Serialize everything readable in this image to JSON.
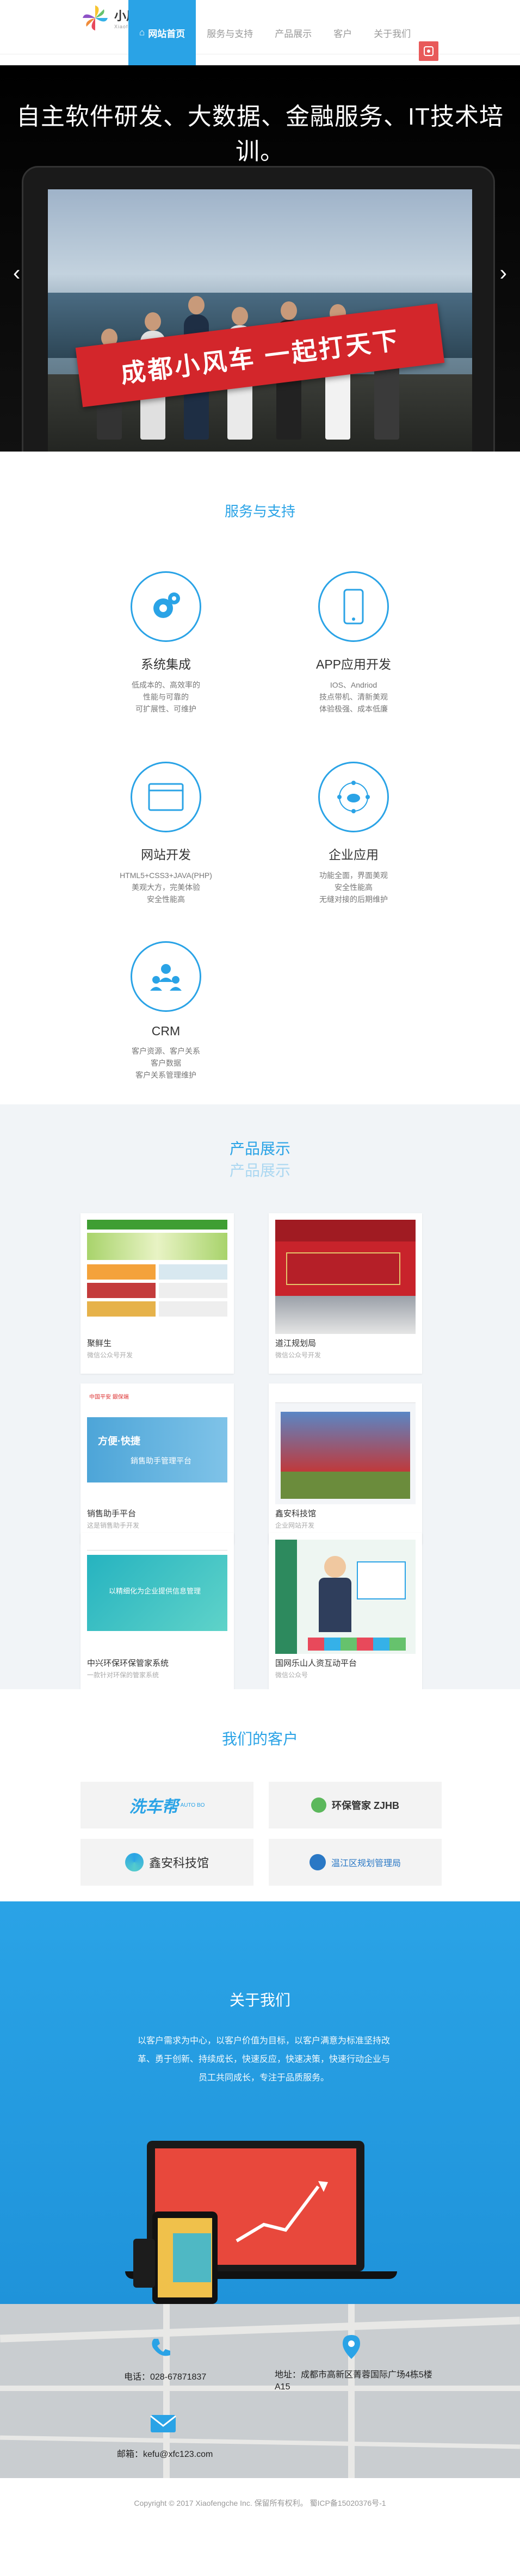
{
  "brand": {
    "name": "小风车",
    "sub": "Xiaofengche"
  },
  "nav": [
    {
      "label": "网站首页",
      "active": true
    },
    {
      "label": "服务与支持"
    },
    {
      "label": "产品展示"
    },
    {
      "label": "客户"
    },
    {
      "label": "关于我们"
    }
  ],
  "banner": {
    "headline": "自主软件研发、大数据、金融服务、IT技术培训。",
    "flag_text": "成都小风车  一起打天下",
    "prev": "‹",
    "next": "›"
  },
  "services": {
    "title": "服务与支持",
    "items": [
      {
        "name": "系统集成",
        "desc": "低成本的、高效率的\n性能与可靠的\n可扩展性、可维护",
        "icon": "gears-icon"
      },
      {
        "name": "APP应用开发",
        "desc": "IOS、Andriod\n技点带机、清新美观\n体验极强、成本低廉",
        "icon": "smartphone-icon"
      },
      {
        "name": "网站开发",
        "desc": "HTML5+CSS3+JAVA(PHP)\n美观大方，完美体验\n安全性能高",
        "icon": "browser-window-icon"
      },
      {
        "name": "企业应用",
        "desc": "功能全面，界面美观\n安全性能高\n无缝对接的后期维护",
        "icon": "network-cloud-icon"
      },
      {
        "name": "CRM",
        "desc": "客户资源、客户关系\n客户数据\n客户关系管理维护",
        "icon": "users-icon"
      }
    ]
  },
  "products": {
    "title": "产品展示",
    "subtitle": "产品展示",
    "items": [
      {
        "name": "聚鲜生",
        "desc": "微信公众号开发"
      },
      {
        "name": "道江规划局",
        "desc": "微信公众号开发"
      },
      {
        "name": "销售助手平台",
        "desc": "这是销售助手开发"
      },
      {
        "name": "鑫安科技馆",
        "desc": "企业网站开发"
      },
      {
        "name": "中兴环保环保管家系统",
        "desc": "一款针对环保的管家系统"
      },
      {
        "name": "国网乐山人资互动平台",
        "desc": "微信公众号"
      }
    ],
    "screens": {
      "p3_header": "中国平安 銀保端",
      "p3_tagline": "銷售助手管理平台",
      "p3_brand": "方便·快捷",
      "p5_banner": "以精细化为企业提供信息管理"
    }
  },
  "clients": {
    "title": "我们的客户",
    "logos": [
      {
        "name": "洗车帮",
        "tag": "AUTO BO"
      },
      {
        "name": "环保管家 ZJHB",
        "tag": ""
      },
      {
        "name": "鑫安科技馆",
        "tag": ""
      },
      {
        "name": "温江区规划管理局",
        "tag": ""
      }
    ]
  },
  "about": {
    "title": "关于我们",
    "text": "以客户需求为中心，以客户价值为目标，以客户满意为标准坚持改革、勇于创新、持续成长，快速反应，快速决策，快速行动企业与员工共同成长，专注于品质服务。"
  },
  "contact": {
    "phone": "电话：028-67871837",
    "address": "地址：成都市高新区菁蓉国际广场4栋5楼A15",
    "email": "邮箱：kefu@xfc123.com"
  },
  "footer": {
    "copyright": "Copyright © 2017 Xiaofengche Inc. 保留所有权利。  蜀ICP备15020376号-1"
  },
  "colors": {
    "accent": "#2aa3e6",
    "flag": "#d3262b",
    "weibo": "#e85a5a"
  }
}
